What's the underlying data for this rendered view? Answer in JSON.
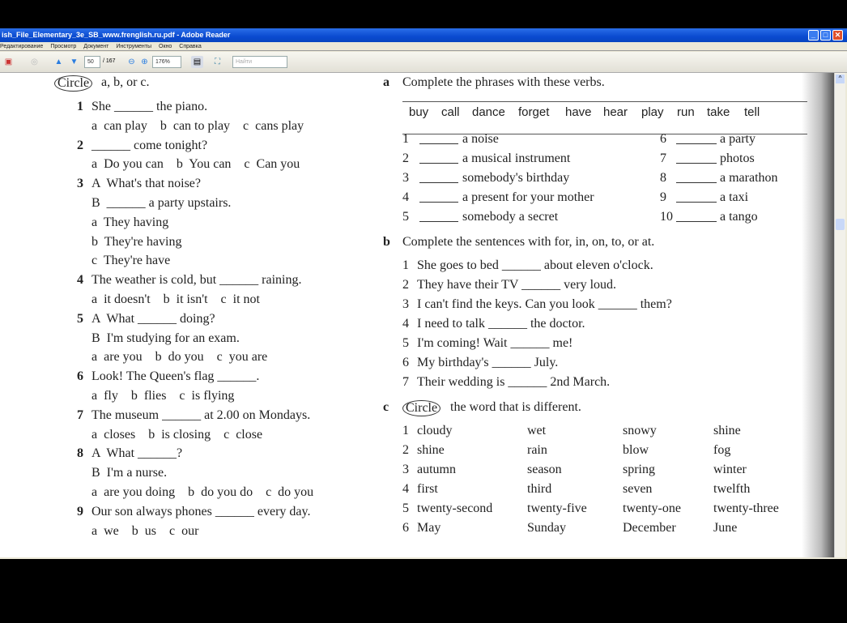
{
  "window": {
    "title": "ish_File_Elementary_3e_SB_www.frenglish.ru.pdf - Adobe Reader",
    "menu": [
      "Редактирование",
      "Просмотр",
      "Документ",
      "Инструменты",
      "Окно",
      "Справка"
    ],
    "page_current": "50",
    "page_total": "/ 167",
    "zoom": "176%",
    "search_placeholder": "Найти"
  },
  "left": {
    "heading_circle": "Circle",
    "heading_rest": "a, b, or c.",
    "lines": [
      [
        "1",
        "She ______ the piano."
      ],
      [
        "",
        "a  can play    b  can to play    c  cans play"
      ],
      [
        "2",
        "______ come tonight?"
      ],
      [
        "",
        "a  Do you can    b  You can    c  Can you"
      ],
      [
        "3",
        "A  What's that noise?"
      ],
      [
        "",
        "B  ______ a party upstairs."
      ],
      [
        "",
        "a  They having"
      ],
      [
        "",
        "b  They're having"
      ],
      [
        "",
        "c  They're have"
      ],
      [
        "4",
        "The weather is cold, but ______ raining."
      ],
      [
        "",
        "a  it doesn't    b  it isn't    c  it not"
      ],
      [
        "5",
        "A  What ______ doing?"
      ],
      [
        "",
        "B  I'm studying for an exam."
      ],
      [
        "",
        "a  are you    b  do you    c  you are"
      ],
      [
        "6",
        "Look! The Queen's flag ______."
      ],
      [
        "",
        "a  fly    b  flies    c  is flying"
      ],
      [
        "7",
        "The museum ______ at 2.00 on Mondays."
      ],
      [
        "",
        "a  closes    b  is closing    c  close"
      ],
      [
        "8",
        "A  What ______?"
      ],
      [
        "",
        "B  I'm a nurse."
      ],
      [
        "",
        "a  are you doing    b  do you do    c  do you"
      ],
      [
        "9",
        "Our son always phones ______ every day."
      ],
      [
        "",
        "a  we    b  us    c  our"
      ]
    ]
  },
  "section_a": {
    "letter": "a",
    "heading": "Complete the phrases with these verbs.",
    "verbs": [
      "buy",
      "call",
      "dance",
      "forget",
      "have",
      "hear",
      "play",
      "run",
      "take",
      "tell"
    ],
    "items": [
      [
        "1",
        "a noise"
      ],
      [
        "2",
        "a musical instrument"
      ],
      [
        "3",
        "somebody's birthday"
      ],
      [
        "4",
        "a present for your mother"
      ],
      [
        "5",
        "somebody a secret"
      ],
      [
        "6",
        "a party"
      ],
      [
        "7",
        "photos"
      ],
      [
        "8",
        "a marathon"
      ],
      [
        "9",
        "a taxi"
      ],
      [
        "10",
        "a tango"
      ]
    ]
  },
  "section_b": {
    "letter": "b",
    "heading": "Complete the sentences with for, in, on, to, or at.",
    "items": [
      [
        "1",
        "She goes to bed ______ about eleven o'clock."
      ],
      [
        "2",
        "They have their TV ______ very loud."
      ],
      [
        "3",
        "I can't find the keys. Can you look ______ them?"
      ],
      [
        "4",
        "I need to talk ______ the doctor."
      ],
      [
        "5",
        "I'm coming! Wait ______ me!"
      ],
      [
        "6",
        "My birthday's ______ July."
      ],
      [
        "7",
        "Their wedding is ______ 2nd March."
      ]
    ]
  },
  "section_c": {
    "letter": "c",
    "heading_circle": "Circle",
    "heading_rest": "the word that is different.",
    "rows": [
      [
        "1",
        "cloudy",
        "wet",
        "snowy",
        "shine"
      ],
      [
        "2",
        "shine",
        "rain",
        "blow",
        "fog"
      ],
      [
        "3",
        "autumn",
        "season",
        "spring",
        "winter"
      ],
      [
        "4",
        "first",
        "third",
        "seven",
        "twelfth"
      ],
      [
        "5",
        "twenty-second",
        "twenty-five",
        "twenty-one",
        "twenty-three"
      ],
      [
        "6",
        "May",
        "Sunday",
        "December",
        "June"
      ]
    ]
  }
}
